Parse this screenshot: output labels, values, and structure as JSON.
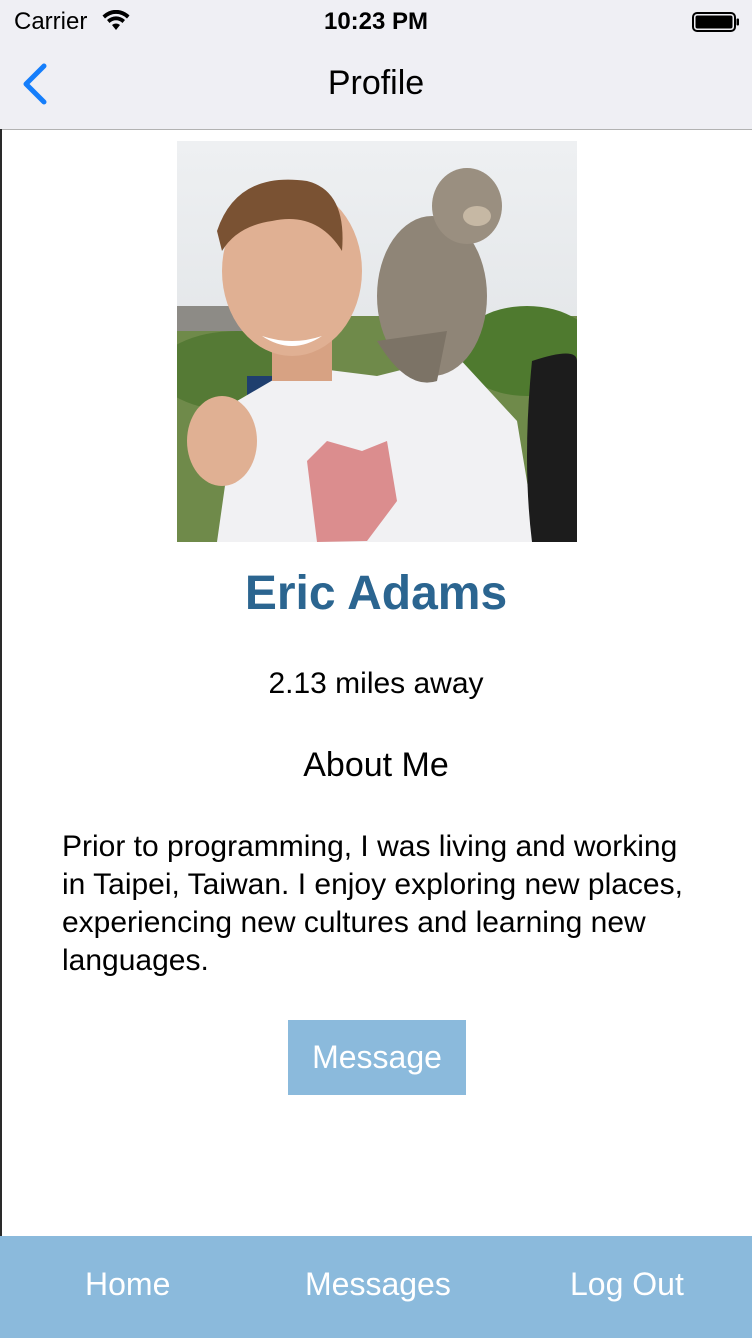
{
  "status_bar": {
    "carrier": "Carrier",
    "time": "10:23 PM",
    "icons": [
      "wifi-icon",
      "battery-icon"
    ]
  },
  "nav": {
    "back_icon": "chevron-left-icon",
    "title": "Profile",
    "tint_color": "#157efb"
  },
  "profile": {
    "photo": "profile-photo",
    "name": "Eric Adams",
    "distance": "2.13 miles away",
    "about_heading": "About Me",
    "about_text": "Prior to programming, I was living and working in Taipei, Taiwan. I enjoy exploring new places, experiencing new cultures and learning new languages.",
    "message_button": "Message"
  },
  "tab_bar": {
    "items": [
      {
        "label": "Home"
      },
      {
        "label": "Messages"
      },
      {
        "label": "Log Out"
      }
    ]
  },
  "colors": {
    "name": "#2b6590",
    "accent": "#8bbadc",
    "nav_background": "#efeff4"
  }
}
